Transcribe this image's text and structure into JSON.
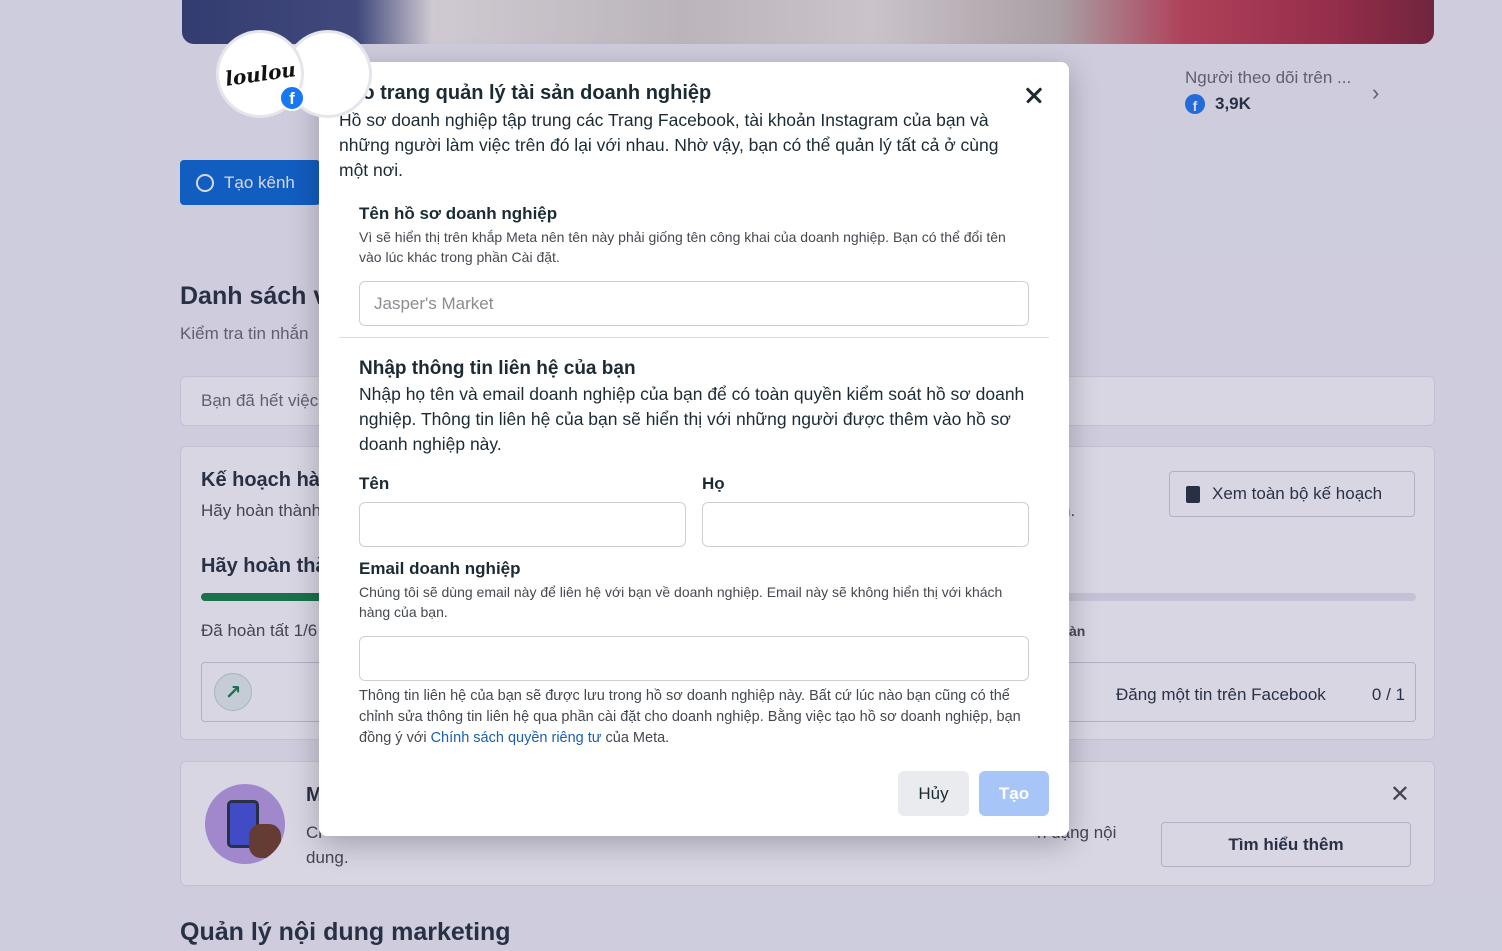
{
  "background": {
    "profile": {
      "avatar_text": "loulou"
    },
    "followers": {
      "label": "Người theo dõi trên ...",
      "count": "3,9K"
    },
    "create_channel_label": "Tạo kênh",
    "list_section": {
      "title": "Danh sách v",
      "subtitle": "Kiểm tra tin nhắn",
      "empty_text": "Bạn đã hết việc"
    },
    "plan_card": {
      "title": "Kế hoạch hàn",
      "subtitle": "Hãy hoàn thành",
      "subtitle_end": "n.",
      "progress_title": "Hãy hoàn thà",
      "progress_fraction": 0.1667,
      "done_text": "Đã hoàn tất 1/6",
      "done_right": "àn",
      "task_label": "Đăng một tin trên Facebook",
      "task_count": "0 / 1",
      "view_plan_label": "Xem toàn bộ kế hoạch"
    },
    "promo_card": {
      "title": "M",
      "text_line1": "Cl",
      "text_line1_end": "h dạng nội",
      "text_line2": "dung.",
      "learn_more_label": "Tìm hiểu thêm"
    },
    "marketing_title": "Quản lý nội dung marketing"
  },
  "modal": {
    "title": "Tạo trang quản lý tài sản doanh nghiệp",
    "intro": "Hồ sơ doanh nghiệp tập trung các Trang Facebook, tài khoản Instagram của bạn và những người làm việc trên đó lại với nhau. Nhờ vậy, bạn có thể quản lý tất cả ở cùng một nơi.",
    "business_name": {
      "label": "Tên hồ sơ doanh nghiệp",
      "help": "Vì sẽ hiển thị trên khắp Meta nên tên này phải giống tên công khai của doanh nghiệp. Bạn có thể đổi tên vào lúc khác trong phần Cài đặt.",
      "placeholder": "Jasper's Market",
      "value": ""
    },
    "contact": {
      "title": "Nhập thông tin liên hệ của bạn",
      "text": "Nhập họ tên và email doanh nghiệp của bạn để có toàn quyền kiểm soát hồ sơ doanh nghiệp. Thông tin liên hệ của bạn sẽ hiển thị với những người được thêm vào hồ sơ doanh nghiệp này.",
      "first_name_label": "Tên",
      "first_name_value": "",
      "last_name_label": "Họ",
      "last_name_value": ""
    },
    "email": {
      "label": "Email doanh nghiệp",
      "help": "Chúng tôi sẽ dùng email này để liên hệ với bạn về doanh nghiệp. Email này sẽ không hiển thị với khách hàng của bạn.",
      "value": ""
    },
    "disclaimer": {
      "text_before": "Thông tin liên hệ của bạn sẽ được lưu trong hồ sơ doanh nghiệp này. Bất cứ lúc nào bạn cũng có thể chỉnh sửa thông tin liên hệ qua phần cài đặt cho doanh nghiệp. Bằng việc tạo hồ sơ doanh nghiệp, bạn đồng ý với ",
      "link_text": "Chính sách quyền riêng tư",
      "text_after": " của Meta."
    },
    "cancel_label": "Hủy",
    "create_label": "Tạo",
    "close_icon": "close-icon"
  },
  "colors": {
    "primary_blue": "#0064d1",
    "facebook_blue": "#1877f2",
    "progress_green": "#0a7e3e",
    "disabled_button": "#a7c6f7",
    "link": "#1a5fb4"
  }
}
